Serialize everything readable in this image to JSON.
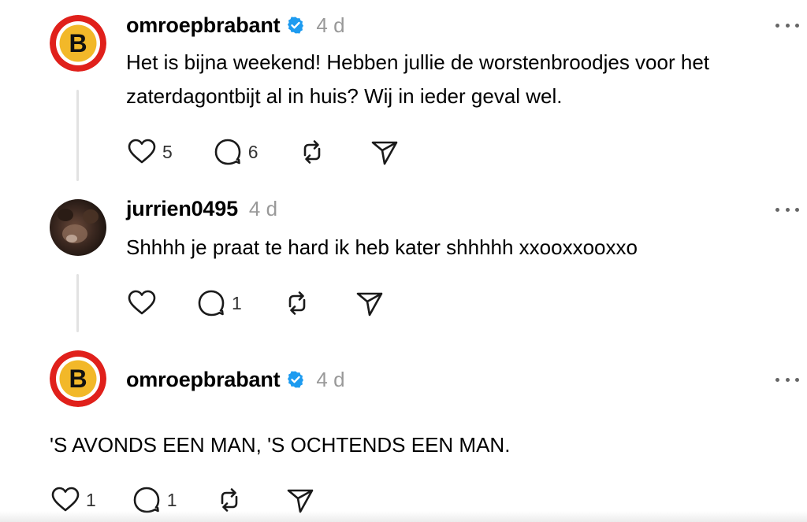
{
  "posts": [
    {
      "username": "omroepbrabant",
      "verified": true,
      "time": "4 d",
      "text_line1": "Het is bijna weekend! Hebben jullie de worstenbroodjes voor het",
      "text_line2": "zaterdagontbijt al in huis? Wij in ieder geval wel.",
      "likes": "5",
      "replies": "6"
    },
    {
      "username": "jurrien0495",
      "verified": false,
      "time": "4 d",
      "text": "Shhhh je praat te hard ik heb kater shhhhh xxooxxooxxo",
      "likes": "",
      "replies": "1"
    },
    {
      "username": "omroepbrabant",
      "verified": true,
      "time": "4 d",
      "text": "'S AVONDS EEN MAN, 'S OCHTENDS EEN MAN.",
      "likes": "1",
      "replies": "1"
    }
  ],
  "avatar_logo_letter": "B",
  "colors": {
    "brand_red": "#e0201b",
    "brand_yellow": "#f2b829",
    "verified_blue": "#1d9bf0",
    "timestamp_gray": "#999999"
  }
}
